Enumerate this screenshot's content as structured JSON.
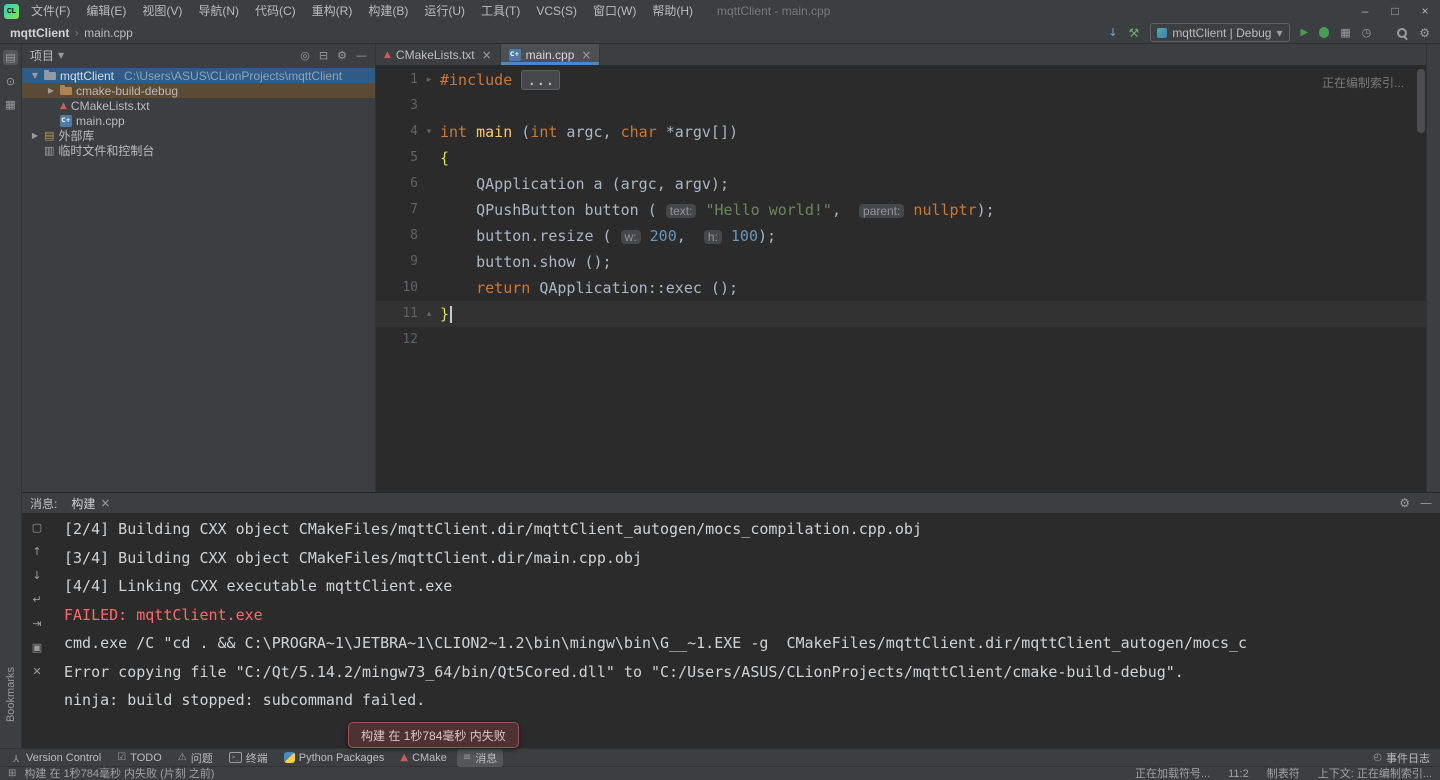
{
  "window": {
    "logo_text": "CL",
    "title": "mqttClient - main.cpp",
    "controls": {
      "min": "–",
      "max": "□",
      "close": "×"
    }
  },
  "menu_items": [
    "文件(F)",
    "编辑(E)",
    "视图(V)",
    "导航(N)",
    "代码(C)",
    "重构(R)",
    "构建(B)",
    "运行(U)",
    "工具(T)",
    "VCS(S)",
    "窗口(W)",
    "帮助(H)"
  ],
  "navbar": {
    "breadcrumbs": [
      "mqttClient",
      "main.cpp"
    ],
    "left_icons": [
      "vcs-update",
      "hammer"
    ],
    "run_config": "mqttClient | Debug",
    "run_icons": [
      "run",
      "debug",
      "coverage",
      "profiler"
    ],
    "right_icons": [
      "search",
      "settings"
    ]
  },
  "left_strip": {
    "icons": [
      "project",
      "commit",
      "structure"
    ],
    "vertical_label": "Bookmarks"
  },
  "project_panel": {
    "title": "项目",
    "header_icons": [
      "locate",
      "collapse",
      "settings",
      "hide"
    ],
    "tree": [
      {
        "indent": 0,
        "arrow": "▼",
        "icon": "folder",
        "label": "mqttClient",
        "path": "C:\\Users\\ASUS\\CLionProjects\\mqttClient",
        "state": "selected"
      },
      {
        "indent": 1,
        "arrow": "▶",
        "icon": "folder-excluded",
        "label": "cmake-build-debug",
        "state": "highlighted"
      },
      {
        "indent": 1,
        "arrow": "",
        "icon": "cmake",
        "label": "CMakeLists.txt",
        "state": ""
      },
      {
        "indent": 1,
        "arrow": "",
        "icon": "cpp",
        "label": "main.cpp",
        "state": ""
      },
      {
        "indent": 0,
        "arrow": "▶",
        "icon": "library",
        "label": "外部库",
        "state": ""
      },
      {
        "indent": 0,
        "arrow": "",
        "icon": "scratch",
        "label": "临时文件和控制台",
        "state": ""
      }
    ]
  },
  "editor": {
    "tabs": [
      {
        "label": "CMakeLists.txt",
        "icon": "cmake",
        "active": false
      },
      {
        "label": "main.cpp",
        "icon": "cpp",
        "active": true
      }
    ],
    "indexing_note": "正在编制索引...",
    "lines": [
      {
        "num": "1",
        "gutter": "▸",
        "segs": [
          {
            "t": "#include ",
            "c": "kw"
          },
          {
            "t": "...",
            "c": "fold"
          }
        ]
      },
      {
        "num": "3",
        "segs": []
      },
      {
        "num": "4",
        "gutter": "▾",
        "segs": [
          {
            "t": "int ",
            "c": "kw"
          },
          {
            "t": "main ",
            "c": "fn"
          },
          {
            "t": "(",
            "c": ""
          },
          {
            "t": "int",
            "c": "kw"
          },
          {
            "t": " argc, ",
            "c": ""
          },
          {
            "t": "char",
            "c": "kw"
          },
          {
            "t": " *argv[])",
            "c": ""
          }
        ]
      },
      {
        "num": "5",
        "segs": [
          {
            "t": "{",
            "c": "brace"
          }
        ]
      },
      {
        "num": "6",
        "segs": [
          {
            "t": "    QApplication a (argc, argv);",
            "c": ""
          }
        ]
      },
      {
        "num": "7",
        "segs": [
          {
            "t": "    QPushButton button ( ",
            "c": ""
          },
          {
            "t": "text:",
            "c": "hint"
          },
          {
            "t": " ",
            "c": ""
          },
          {
            "t": "\"Hello world!\"",
            "c": "str"
          },
          {
            "t": ",  ",
            "c": ""
          },
          {
            "t": "parent:",
            "c": "hint"
          },
          {
            "t": " ",
            "c": ""
          },
          {
            "t": "nullptr",
            "c": "kw"
          },
          {
            "t": ");",
            "c": ""
          }
        ]
      },
      {
        "num": "8",
        "segs": [
          {
            "t": "    button.resize ( ",
            "c": ""
          },
          {
            "t": "w:",
            "c": "hint"
          },
          {
            "t": " ",
            "c": ""
          },
          {
            "t": "200",
            "c": "num"
          },
          {
            "t": ",  ",
            "c": ""
          },
          {
            "t": "h:",
            "c": "hint"
          },
          {
            "t": " ",
            "c": ""
          },
          {
            "t": "100",
            "c": "num"
          },
          {
            "t": ");",
            "c": ""
          }
        ]
      },
      {
        "num": "9",
        "segs": [
          {
            "t": "    button.show ();",
            "c": ""
          }
        ]
      },
      {
        "num": "10",
        "segs": [
          {
            "t": "    ",
            "c": ""
          },
          {
            "t": "return",
            "c": "kw"
          },
          {
            "t": " QApplication::exec ();",
            "c": ""
          }
        ]
      },
      {
        "num": "11",
        "gutter": "▴",
        "segs": [
          {
            "t": "}",
            "c": "brace"
          }
        ],
        "caret": true,
        "current": true
      },
      {
        "num": "12",
        "segs": []
      }
    ]
  },
  "console": {
    "panel_label": "消息:",
    "tab_label": "构建",
    "header_icons": [
      "settings",
      "hide"
    ],
    "toolbar_icons": [
      "pin",
      "up",
      "down",
      "soft-wrap",
      "scroll-end",
      "print",
      "clear"
    ],
    "lines": [
      {
        "c": "",
        "t": "[2/4] Building CXX object CMakeFiles/mqttClient.dir/mqttClient_autogen/mocs_compilation.cpp.obj"
      },
      {
        "c": "",
        "t": "[3/4] Building CXX object CMakeFiles/mqttClient.dir/main.cpp.obj"
      },
      {
        "c": "",
        "t": "[4/4] Linking CXX executable mqttClient.exe"
      },
      {
        "c": "err",
        "t": "FAILED: mqttClient.exe"
      },
      {
        "c": "",
        "t": "cmd.exe /C \"cd . && C:\\PROGRA~1\\JETBRA~1\\CLION2~1.2\\bin\\mingw\\bin\\G__~1.EXE -g  CMakeFiles/mqttClient.dir/mqttClient_autogen/mocs_c"
      },
      {
        "c": "",
        "t": "Error copying file \"C:/Qt/5.14.2/mingw73_64/bin/Qt5Cored.dll\" to \"C:/Users/ASUS/CLionProjects/mqttClient/cmake-build-debug\"."
      },
      {
        "c": "",
        "t": "ninja: build stopped: subcommand failed."
      }
    ]
  },
  "balloon": {
    "text": "构建 在 1秒784毫秒 内失败"
  },
  "bottom_tabs": [
    {
      "label": "Version Control",
      "icon": "branch",
      "active": false
    },
    {
      "label": "TODO",
      "icon": "todo",
      "active": false
    },
    {
      "label": "问题",
      "icon": "problems",
      "active": false
    },
    {
      "label": "终端",
      "icon": "terminal",
      "active": false
    },
    {
      "label": "Python Packages",
      "icon": "python",
      "active": false
    },
    {
      "label": "CMake",
      "icon": "cmake",
      "active": false
    },
    {
      "label": "消息",
      "icon": "messages",
      "active": true
    }
  ],
  "event_log": {
    "label": "事件日志",
    "icon": "event-log"
  },
  "status_bar": {
    "left_icon": "grid",
    "left": "构建 在 1秒784毫秒 内失败 (片刻 之前)",
    "right": [
      "正在加载符号...",
      "11:2",
      "制表符",
      "上下文: 正在编制索引..."
    ]
  }
}
